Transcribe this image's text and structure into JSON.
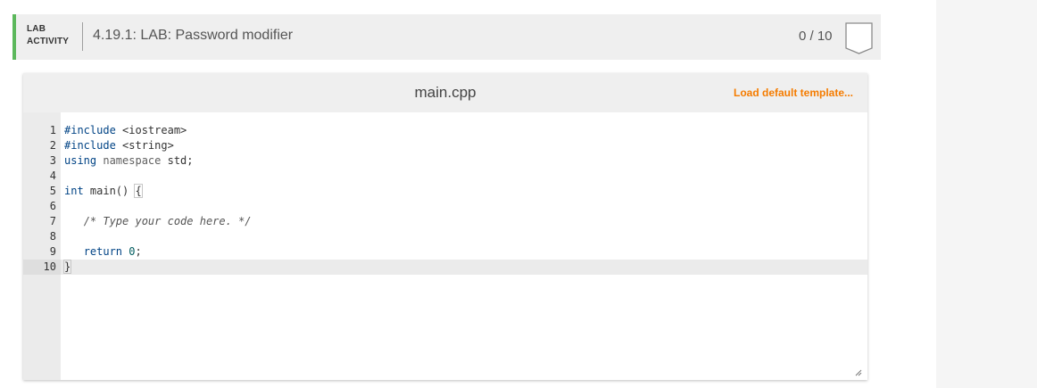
{
  "activity": {
    "type_line1": "LAB",
    "type_line2": "ACTIVITY",
    "title": "4.19.1: LAB: Password modifier",
    "score": "0 / 10",
    "accent_color": "#5cb85c"
  },
  "editor": {
    "file_name": "main.cpp",
    "load_template_label": "Load default template...",
    "load_template_color": "#f57c00",
    "line_numbers": [
      "1",
      "2",
      "3",
      "4",
      "5",
      "6",
      "7",
      "8",
      "9",
      "10"
    ],
    "lines": [
      {
        "segments": [
          {
            "cls": "kw",
            "text": "#include"
          },
          {
            "cls": "",
            "text": " <iostream>"
          }
        ]
      },
      {
        "segments": [
          {
            "cls": "kw",
            "text": "#include"
          },
          {
            "cls": "",
            "text": " <string>"
          }
        ]
      },
      {
        "segments": [
          {
            "cls": "kw",
            "text": "using"
          },
          {
            "cls": "nm",
            "text": " namespace"
          },
          {
            "cls": "",
            "text": " std;"
          }
        ]
      },
      {
        "segments": []
      },
      {
        "segments": [
          {
            "cls": "kw",
            "text": "int"
          },
          {
            "cls": "",
            "text": " main() "
          },
          {
            "cls": "brace",
            "text": "{"
          }
        ]
      },
      {
        "segments": []
      },
      {
        "segments": [
          {
            "cls": "",
            "text": "   "
          },
          {
            "cls": "cm",
            "text": "/* Type your code here. */"
          }
        ]
      },
      {
        "segments": []
      },
      {
        "segments": [
          {
            "cls": "",
            "text": "   "
          },
          {
            "cls": "kw",
            "text": "return"
          },
          {
            "cls": "",
            "text": " "
          },
          {
            "cls": "num",
            "text": "0"
          },
          {
            "cls": "",
            "text": ";"
          }
        ]
      },
      {
        "segments": [
          {
            "cls": "brace",
            "text": "}"
          }
        ]
      }
    ],
    "active_line": 10
  }
}
